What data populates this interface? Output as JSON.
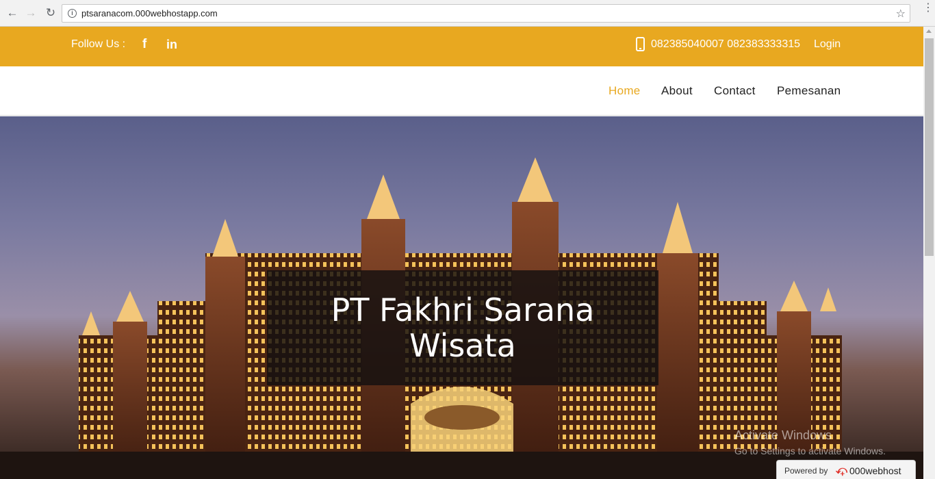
{
  "browser": {
    "url": "ptsaranacom.000webhostapp.com",
    "icons": {
      "back": "arrow-left-icon",
      "forward": "arrow-right-icon",
      "reload": "reload-icon",
      "info": "info-icon",
      "bookmark": "star-icon",
      "menu": "more-vert-icon"
    }
  },
  "topbar": {
    "follow_label": "Follow Us :",
    "facebook_glyph": "f",
    "linkedin_glyph": "in",
    "phones": "082385040007 082383333315",
    "login": "Login"
  },
  "nav": {
    "items": [
      {
        "label": "Home",
        "active": true
      },
      {
        "label": "About"
      },
      {
        "label": "Contact"
      },
      {
        "label": "Pemesanan"
      }
    ]
  },
  "hero": {
    "title_line1": "PT Fakhri Sarana",
    "title_line2": "Wisata"
  },
  "watermark": {
    "line1": "Activate Windows",
    "line2": "Go to Settings to activate Windows."
  },
  "powered": {
    "label": "Powered by",
    "brand": "000webhost"
  },
  "colors": {
    "accent": "#e8a820",
    "overlay": "#141010"
  }
}
